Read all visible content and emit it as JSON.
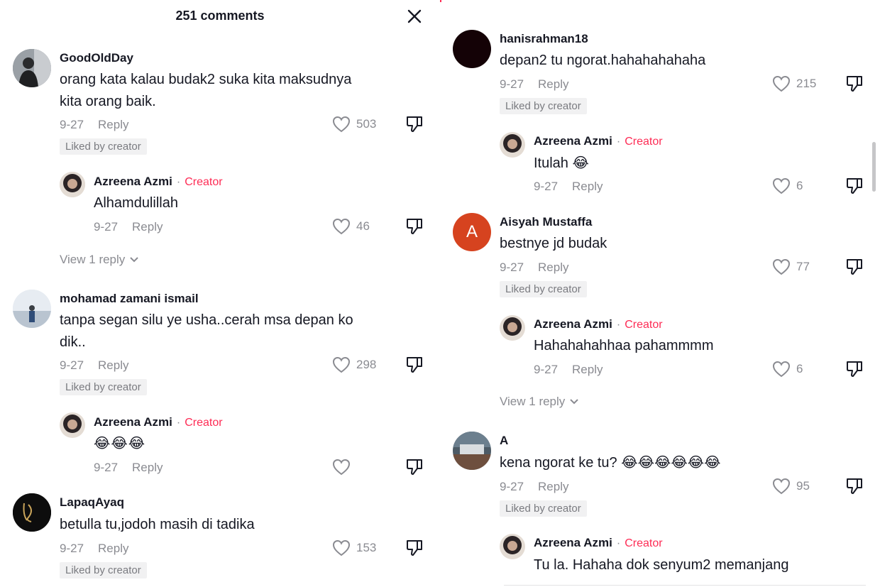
{
  "header": {
    "title": "251 comments"
  },
  "tags": {
    "creator": "Creator",
    "liked_by_creator": "Liked by creator",
    "reply": "Reply"
  },
  "left": {
    "c1": {
      "user": "GoodOldDay",
      "text1": "orang kata kalau budak2 suka kita maksudnya",
      "text2": "kita orang baik.",
      "date": "9-27",
      "likes": "503"
    },
    "r1": {
      "user": "Azreena Azmi",
      "text": "Alhamdulillah",
      "date": "9-27",
      "likes": "46"
    },
    "view1": "View 1 reply",
    "c2": {
      "user": "mohamad zamani ismail",
      "text1": "tanpa segan silu ye usha..cerah msa depan ko",
      "text2": "dik..",
      "date": "9-27",
      "likes": "298"
    },
    "r2": {
      "user": "Azreena Azmi",
      "text": "😂😂😂",
      "date": "9-27",
      "likes": ""
    },
    "c3": {
      "user": "LapaqAyaq",
      "text": "betulla tu,jodoh masih di tadika",
      "date": "9-27",
      "likes": "153"
    }
  },
  "right": {
    "c1": {
      "user": "hanisrahman18",
      "text": "depan2 tu ngorat.hahahahahaha",
      "date": "9-27",
      "likes": "215"
    },
    "r1": {
      "user": "Azreena Azmi",
      "text": "Itulah 😂",
      "date": "9-27",
      "likes": "6"
    },
    "c2": {
      "user": "Aisyah Mustaffa",
      "avatar_letter": "A",
      "text": "bestnye jd budak",
      "date": "9-27",
      "likes": "77"
    },
    "r2": {
      "user": "Azreena Azmi",
      "text": "Hahahahahhaa pahammmm",
      "date": "9-27",
      "likes": "6"
    },
    "view1": "View 1 reply",
    "c3": {
      "user": "A",
      "text": "kena ngorat ke tu? 😂😂😂😂😂😂",
      "date": "9-27",
      "likes": "95"
    },
    "r3": {
      "user": "Azreena Azmi",
      "text": "Tu la. Hahaha dok senyum2 memanjang"
    }
  },
  "colors": {
    "creator": "#fe2c55",
    "secondary": "#8a8b91",
    "badge_bg": "#f1f1f2",
    "text": "#161823"
  }
}
